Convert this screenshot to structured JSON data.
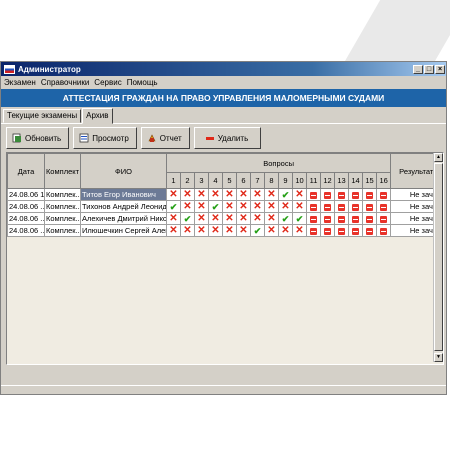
{
  "window": {
    "title": "Администратор",
    "buttons": [
      "_",
      "□",
      "×"
    ]
  },
  "menu": [
    "Экзамен",
    "Справочники",
    "Сервис",
    "Помощь"
  ],
  "banner": "АТТЕСТАЦИЯ ГРАЖДАН НА ПРАВО УПРАВЛЕНИЯ МАЛОМЕРНЫМИ СУДАМИ",
  "tabs": [
    "Текущие экзамены",
    "Архив"
  ],
  "toolbar": {
    "refresh": "Обновить",
    "view": "Просмотр",
    "report": "Отчет",
    "delete": "Удалить"
  },
  "table": {
    "headers": {
      "date": "Дата",
      "set": "Комплект",
      "name": "ФИО",
      "questions": "Вопросы",
      "result": "Результат"
    },
    "question_numbers": [
      "1",
      "2",
      "3",
      "4",
      "5",
      "6",
      "7",
      "8",
      "9",
      "10",
      "11",
      "12",
      "13",
      "14",
      "15",
      "16"
    ],
    "rows": [
      {
        "date": "24.08.06 1...",
        "set": "Комплек...",
        "name": "Титов Егор Иванович",
        "answers": [
          "x",
          "x",
          "x",
          "x",
          "x",
          "x",
          "x",
          "x",
          "v",
          "x",
          "b",
          "b",
          "b",
          "b",
          "b",
          "b"
        ],
        "result": "Не зачет"
      },
      {
        "date": "24.08.06 ...",
        "set": "Комплек...",
        "name": "Тихонов Андрей Леонид...",
        "answers": [
          "v",
          "x",
          "x",
          "v",
          "x",
          "x",
          "x",
          "x",
          "x",
          "x",
          "b",
          "b",
          "b",
          "b",
          "b",
          "b"
        ],
        "result": "Не зачет"
      },
      {
        "date": "24.08.06 ...",
        "set": "Комплек...",
        "name": "Алехичев Дмитрий Нико...",
        "answers": [
          "x",
          "v",
          "x",
          "x",
          "x",
          "x",
          "x",
          "x",
          "v",
          "v",
          "b",
          "b",
          "b",
          "b",
          "b",
          "b"
        ],
        "result": "Не зачет"
      },
      {
        "date": "24.08.06 ...",
        "set": "Комплек...",
        "name": "Илюшечкин Сергей Алекс...",
        "answers": [
          "x",
          "x",
          "x",
          "x",
          "x",
          "x",
          "v",
          "x",
          "x",
          "x",
          "b",
          "b",
          "b",
          "b",
          "b",
          "b"
        ],
        "result": "Не зачет"
      }
    ]
  },
  "legend_icons": {
    "v": "check-icon",
    "x": "cross-icon",
    "b": "no-entry-icon"
  },
  "colors": {
    "banner": "#1e64a8",
    "check": "#26a017",
    "cross": "#e02818",
    "selected": "#6c7a96"
  }
}
